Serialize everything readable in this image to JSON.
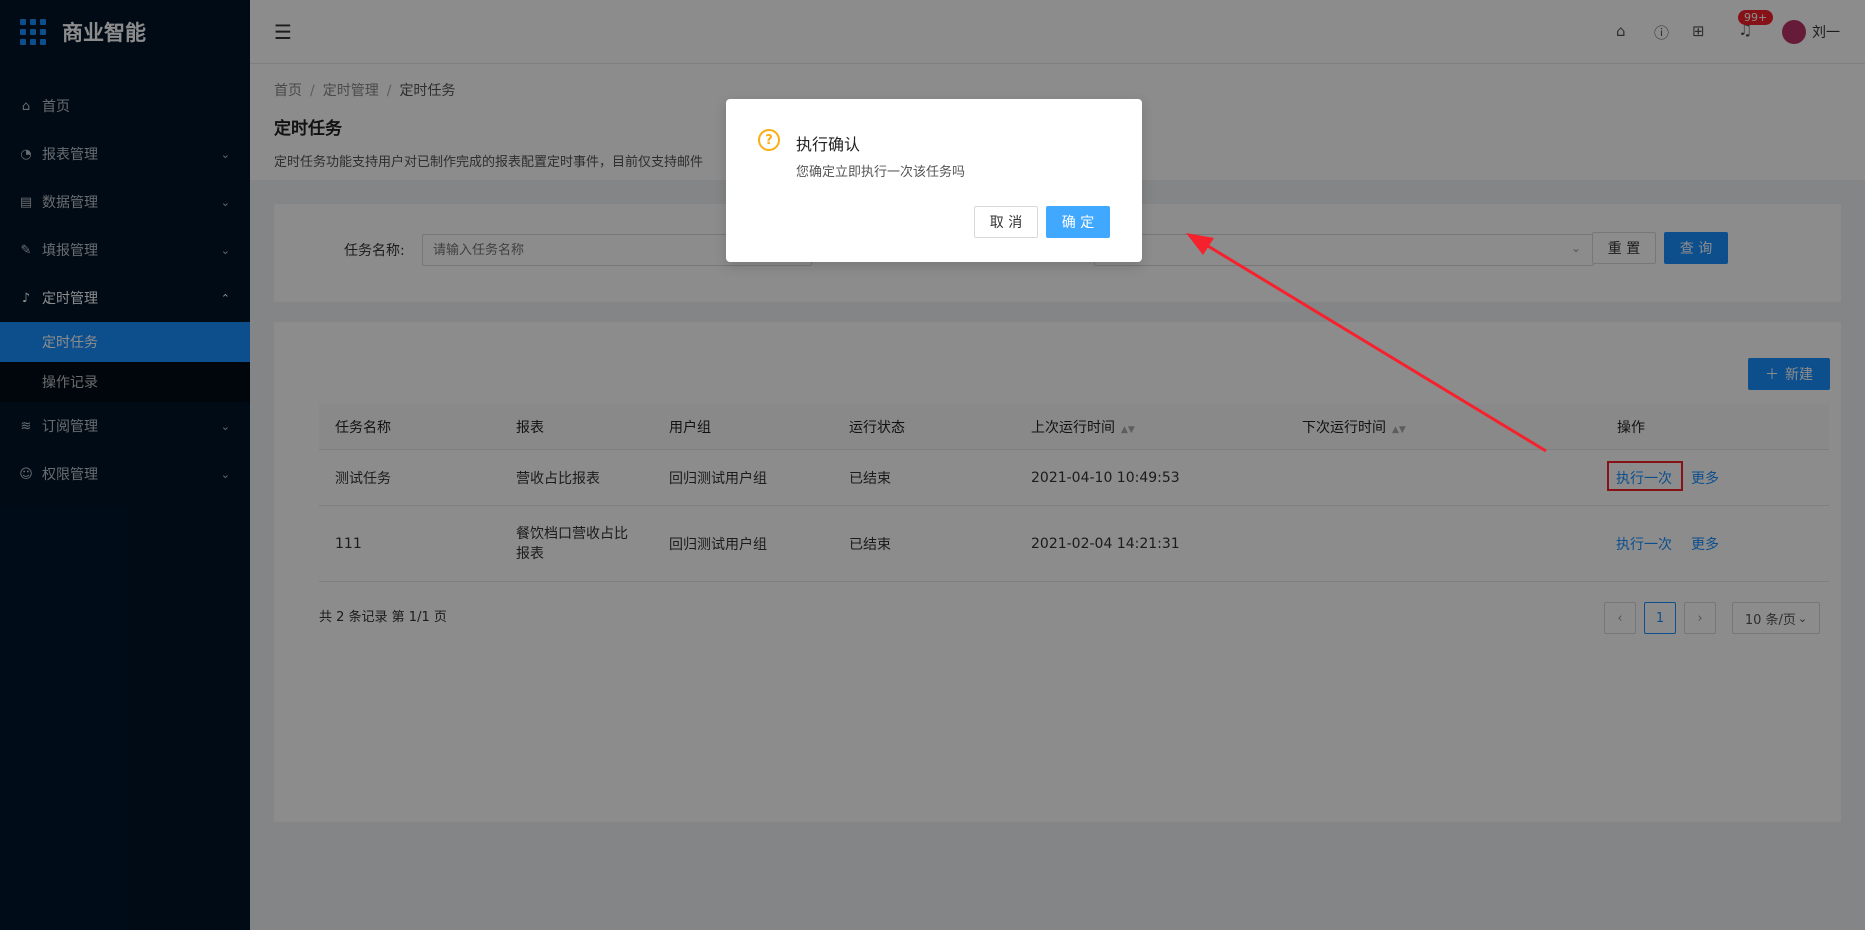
{
  "app": {
    "title": "商业智能"
  },
  "sidebar": {
    "items": [
      {
        "label": "首页",
        "icon": "home-icon"
      },
      {
        "label": "报表管理",
        "icon": "dashboard-icon"
      },
      {
        "label": "数据管理",
        "icon": "database-icon"
      },
      {
        "label": "填报管理",
        "icon": "edit-form-icon"
      },
      {
        "label": "定时管理",
        "icon": "bell-icon"
      },
      {
        "label": "订阅管理",
        "icon": "wifi-icon"
      },
      {
        "label": "权限管理",
        "icon": "user-icon"
      }
    ],
    "sub_items": [
      {
        "label": "定时任务",
        "active": true
      },
      {
        "label": "操作记录",
        "active": false
      }
    ]
  },
  "header": {
    "notification_count": "99+",
    "username": "刘一"
  },
  "breadcrumb": [
    "首页",
    "定时管理",
    "定时任务"
  ],
  "page": {
    "title": "定时任务",
    "description": "定时任务功能支持用户对已制作完成的报表配置定时事件，目前仅支持邮件"
  },
  "search": {
    "label": "任务名称:",
    "placeholder": "请输入任务名称",
    "reset_label": "重 置",
    "query_label": "查 询"
  },
  "table": {
    "new_label": "新建",
    "columns": [
      "任务名称",
      "报表",
      "用户组",
      "运行状态",
      "上次运行时间",
      "下次运行时间",
      "操作"
    ],
    "rows": [
      {
        "name": "测试任务",
        "report": "营收占比报表",
        "group": "回归测试用户组",
        "status": "已结束",
        "last_run": "2021-04-10 10:49:53",
        "next_run": "",
        "action1": "执行一次",
        "action2": "更多"
      },
      {
        "name": "111",
        "report": "餐饮档口营收占比报表",
        "report_line1": "餐饮档口营收占比",
        "report_line2": "报表",
        "group": "回归测试用户组",
        "status": "已结束",
        "last_run": "2021-02-04 14:21:31",
        "next_run": "",
        "action1": "执行一次",
        "action2": "更多"
      }
    ],
    "summary": "共 2 条记录 第 1/1 页",
    "current_page": "1",
    "page_size": "10 条/页"
  },
  "modal": {
    "title": "执行确认",
    "message": "您确定立即执行一次该任务吗",
    "cancel_label": "取 消",
    "ok_label": "确 定"
  },
  "colors": {
    "primary": "#1890ff",
    "sidebar_bg": "#001529",
    "annotation": "#f5222d",
    "warning": "#faad14"
  }
}
